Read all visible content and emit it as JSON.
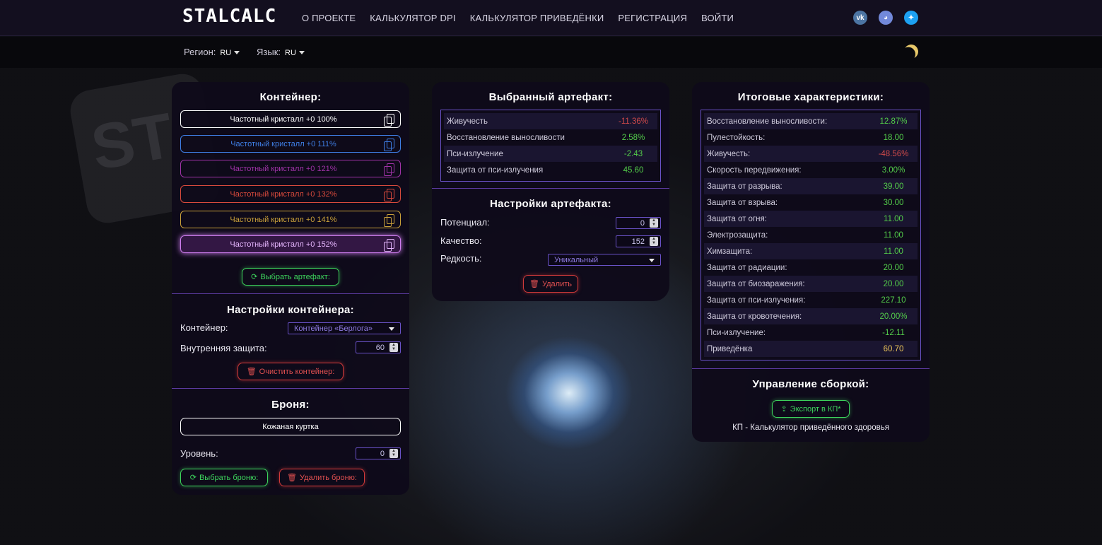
{
  "brand": {
    "logo": "STALCALC"
  },
  "nav": [
    "О ПРОЕКТЕ",
    "КАЛЬКУЛЯТОР DPI",
    "КАЛЬКУЛЯТОР ПРИВЕДЁНКИ",
    "РЕГИСТРАЦИЯ",
    "ВОЙТИ"
  ],
  "social": {
    "vk": "vk",
    "discord": "discord",
    "twitter": "twitter"
  },
  "subbar": {
    "region_label": "Регион:",
    "region_value": "RU",
    "lang_label": "Язык:",
    "lang_value": "RU"
  },
  "container_panel": {
    "title": "Контейнер:",
    "slots": [
      {
        "label": "Частотный кристалл +0 100%",
        "color": "#ffffff"
      },
      {
        "label": "Частотный кристалл +0 111%",
        "color": "#3f7fe6"
      },
      {
        "label": "Частотный кристалл +0 121%",
        "color": "#a033a8"
      },
      {
        "label": "Частотный кристалл +0 132%",
        "color": "#d84a3c"
      },
      {
        "label": "Частотный кристалл +0 141%",
        "color": "#c9a03a"
      },
      {
        "label": "Частотный кристалл +0 152%",
        "color": "#d07ef0"
      }
    ],
    "select_artifact_label": "Выбрать артефакт:",
    "settings_title": "Настройки контейнера:",
    "container_label": "Контейнер:",
    "container_value": "Контейнер «Берлога»",
    "inner_protection_label": "Внутренняя защита:",
    "inner_protection_value": "60",
    "clear_label": "Очистить контейнер:",
    "armor_title": "Броня:",
    "armor_value": "Кожаная куртка",
    "level_label": "Уровень:",
    "level_value": "0",
    "select_armor_label": "Выбрать броню:",
    "delete_armor_label": "Удалить броню:"
  },
  "artifact_panel": {
    "title": "Выбранный артефакт:",
    "stats": [
      {
        "name": "Живучесть",
        "value": "-11.36%",
        "tone": "neg"
      },
      {
        "name": "Восстановление выносливости",
        "value": "2.58%",
        "tone": "pos"
      },
      {
        "name": "Пси-излучение",
        "value": "-2.43",
        "tone": "pos"
      },
      {
        "name": "Защита от пси-излучения",
        "value": "45.60",
        "tone": "pos"
      }
    ],
    "settings_title": "Настройки артефакта:",
    "potential_label": "Потенциал:",
    "potential_value": "0",
    "quality_label": "Качество:",
    "quality_value": "152",
    "rarity_label": "Редкость:",
    "rarity_value": "Уникальный",
    "delete_label": "Удалить"
  },
  "total_panel": {
    "title": "Итоговые характеристики:",
    "stats": [
      {
        "name": "Восстановление выносливости:",
        "value": "12.87%",
        "tone": "pos"
      },
      {
        "name": "Пулестойкость:",
        "value": "18.00",
        "tone": "pos"
      },
      {
        "name": "Живучесть:",
        "value": "-48.56%",
        "tone": "neg"
      },
      {
        "name": "Скорость передвижения:",
        "value": "3.00%",
        "tone": "pos"
      },
      {
        "name": "Защита от разрыва:",
        "value": "39.00",
        "tone": "pos"
      },
      {
        "name": "Защита от взрыва:",
        "value": "30.00",
        "tone": "pos"
      },
      {
        "name": "Защита от огня:",
        "value": "11.00",
        "tone": "pos"
      },
      {
        "name": "Электрозащита:",
        "value": "11.00",
        "tone": "pos"
      },
      {
        "name": "Химзащита:",
        "value": "11.00",
        "tone": "pos"
      },
      {
        "name": "Защита от радиации:",
        "value": "20.00",
        "tone": "pos"
      },
      {
        "name": "Защита от биозаражения:",
        "value": "20.00",
        "tone": "pos"
      },
      {
        "name": "Защита от пси-излучения:",
        "value": "227.10",
        "tone": "pos"
      },
      {
        "name": "Защита от кровотечения:",
        "value": "20.00%",
        "tone": "pos"
      },
      {
        "name": "Пси-излучение:",
        "value": "-12.11",
        "tone": "pos"
      },
      {
        "name": "Приведёнка",
        "value": "60.70",
        "tone": "gold"
      }
    ],
    "build_title": "Управление сборкой:",
    "export_label": "Экспорт в КП*",
    "note": "КП - Калькулятор приведённого здоровья"
  }
}
